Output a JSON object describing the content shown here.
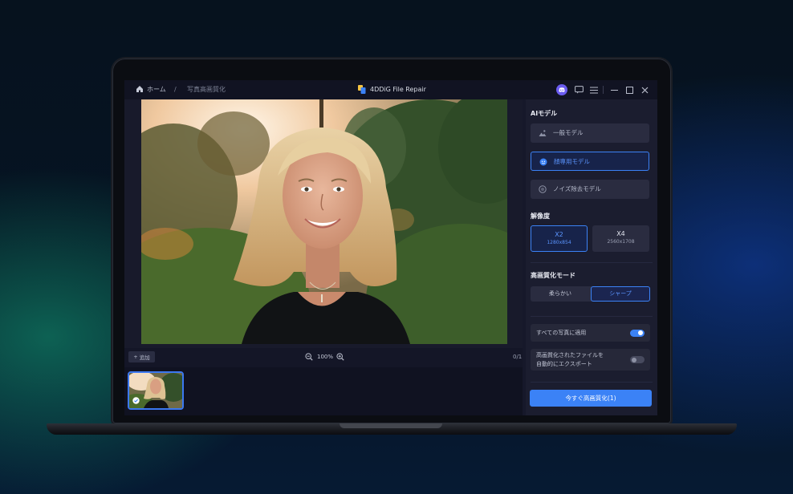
{
  "titlebar": {
    "breadcrumb_home": "ホーム",
    "breadcrumb_sep": "/",
    "breadcrumb_current": "写真高画質化",
    "app_title": "4DDiG File Repair"
  },
  "canvas": {
    "add_button_label": "追加",
    "zoom_level": "100%",
    "page_count": "0/1"
  },
  "panel": {
    "ai_model_title": "AIモデル",
    "models": [
      {
        "label": "一般モデル",
        "icon": "landscape-icon",
        "selected": false
      },
      {
        "label": "顔専用モデル",
        "icon": "face-icon",
        "selected": true
      },
      {
        "label": "ノイズ除去モデル",
        "icon": "circle-icon",
        "selected": false
      }
    ],
    "resolution_title": "解像度",
    "resolutions": [
      {
        "label": "X2",
        "size": "1280x854",
        "selected": true
      },
      {
        "label": "X4",
        "size": "2560x1708",
        "selected": false
      }
    ],
    "mode_title": "高画質化モード",
    "modes": [
      {
        "label": "柔らかい",
        "selected": false
      },
      {
        "label": "シャープ",
        "selected": true
      }
    ],
    "apply_all_label": "すべての写真に適用",
    "apply_all_on": true,
    "auto_export_line1": "高画質化されたファイルを",
    "auto_export_line2": "自動的にエクスポート",
    "auto_export_on": false,
    "enhance_button": "今すぐ高画質化(1)"
  },
  "colors": {
    "accent": "#3b82f6",
    "panel_bg": "#1b1d2f",
    "screen_bg": "#16182a"
  }
}
